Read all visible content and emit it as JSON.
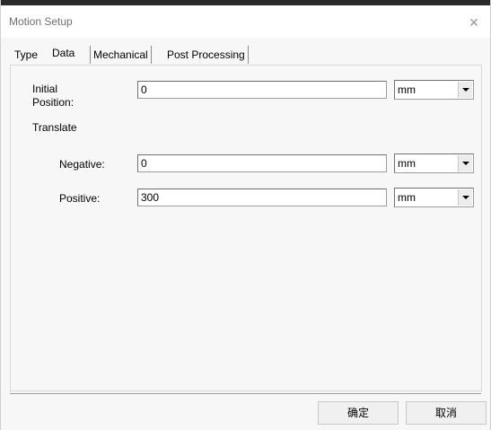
{
  "window": {
    "title": "Motion Setup",
    "close_glyph": "✕"
  },
  "tabs": [
    {
      "label": "Type",
      "active": false
    },
    {
      "label": "Data",
      "active": true
    },
    {
      "label": "Mechanical",
      "active": false
    },
    {
      "label": "Post Processing",
      "active": false
    }
  ],
  "form": {
    "initial_position": {
      "label": "Initial Position:",
      "value": "0",
      "unit": "mm"
    },
    "translate_header": "Translate",
    "negative": {
      "label": "Negative:",
      "value": "0",
      "unit": "mm"
    },
    "positive": {
      "label": "Positive:",
      "value": "300",
      "unit": "mm"
    }
  },
  "buttons": {
    "ok": "确定",
    "cancel": "取消"
  },
  "icons": {
    "close": "close-icon",
    "dropdown": "chevron-down-icon"
  },
  "colors": {
    "title_text": "#6f6f6f",
    "dialog_bg": "#f7f7f7",
    "field_bg": "#ffffff"
  }
}
